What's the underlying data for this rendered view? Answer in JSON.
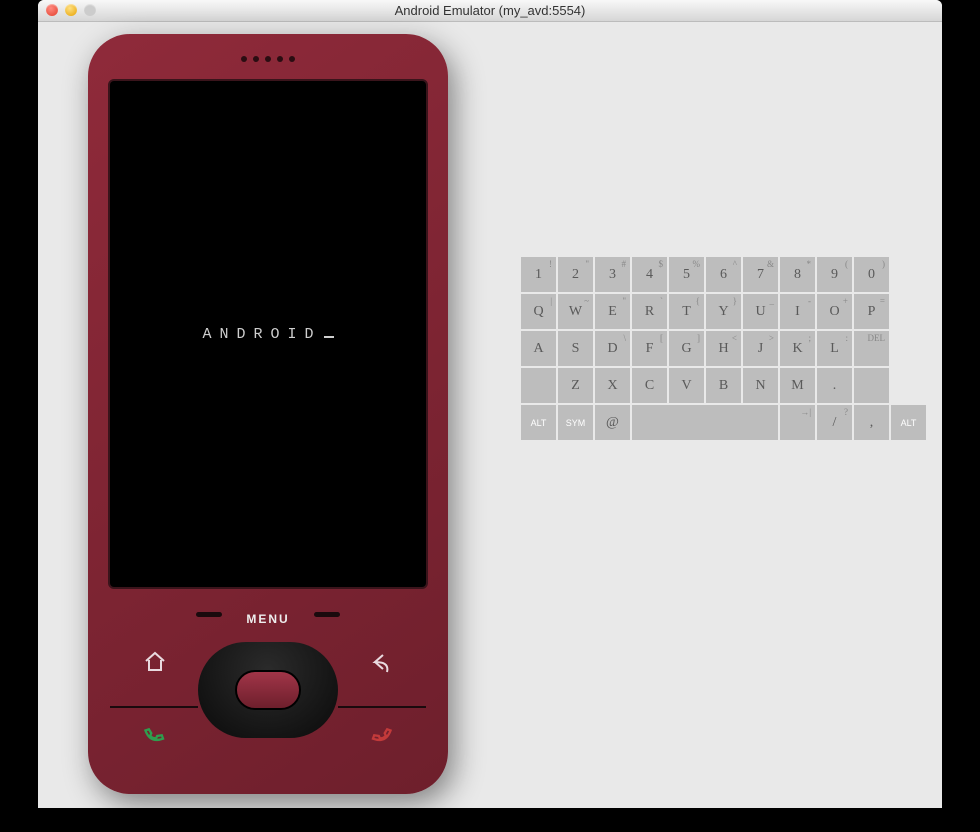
{
  "window": {
    "title": "Android Emulator (my_avd:5554)"
  },
  "device": {
    "screen_text": "ANDROID",
    "menu_label": "MENU"
  },
  "keyboard": {
    "rows": [
      [
        {
          "main": "1",
          "sup": "!"
        },
        {
          "main": "2",
          "sup": "\""
        },
        {
          "main": "3",
          "sup": "#"
        },
        {
          "main": "4",
          "sup": "$"
        },
        {
          "main": "5",
          "sup": "%"
        },
        {
          "main": "6",
          "sup": "^"
        },
        {
          "main": "7",
          "sup": "&"
        },
        {
          "main": "8",
          "sup": "*"
        },
        {
          "main": "9",
          "sup": "("
        },
        {
          "main": "0",
          "sup": ")"
        }
      ],
      [
        {
          "main": "Q",
          "sup": "|"
        },
        {
          "main": "W",
          "sup": "~"
        },
        {
          "main": "E",
          "sup": "\""
        },
        {
          "main": "R",
          "sup": "`"
        },
        {
          "main": "T",
          "sup": "{"
        },
        {
          "main": "Y",
          "sup": "}"
        },
        {
          "main": "U",
          "sup": "_"
        },
        {
          "main": "I",
          "sup": "-"
        },
        {
          "main": "O",
          "sup": "+"
        },
        {
          "main": "P",
          "sup": "="
        }
      ],
      [
        {
          "main": "A",
          "sup": ""
        },
        {
          "main": "S",
          "sup": ""
        },
        {
          "main": "D",
          "sup": "\\"
        },
        {
          "main": "F",
          "sup": "["
        },
        {
          "main": "G",
          "sup": "]"
        },
        {
          "main": "H",
          "sup": "<"
        },
        {
          "main": "J",
          "sup": ">"
        },
        {
          "main": "K",
          "sup": ";"
        },
        {
          "main": "L",
          "sup": ":"
        },
        {
          "main": "",
          "sup": "DEL",
          "name": "delete-key",
          "icon": "del"
        }
      ],
      [
        {
          "main": "",
          "sup": "",
          "name": "shift-key",
          "icon": "shift"
        },
        {
          "main": "Z",
          "sup": ""
        },
        {
          "main": "X",
          "sup": ""
        },
        {
          "main": "C",
          "sup": ""
        },
        {
          "main": "V",
          "sup": ""
        },
        {
          "main": "B",
          "sup": ""
        },
        {
          "main": "N",
          "sup": ""
        },
        {
          "main": "M",
          "sup": ""
        },
        {
          "main": ".",
          "sup": ""
        },
        {
          "main": "",
          "sup": "",
          "name": "enter-key",
          "icon": "enter"
        }
      ],
      [
        {
          "main": "ALT",
          "cls": "mod",
          "name": "alt-left-key"
        },
        {
          "main": "SYM",
          "cls": "mod",
          "name": "sym-key"
        },
        {
          "main": "@",
          "name": "at-key"
        },
        {
          "main": "",
          "cls": "wide4",
          "name": "space-key",
          "icon": "space"
        },
        {
          "main": "",
          "sup": "→|",
          "name": "tab-key",
          "icon": "tab"
        },
        {
          "main": "/",
          "sup": "?",
          "name": "slash-key"
        },
        {
          "main": ",",
          "sup": "",
          "name": "comma-key"
        },
        {
          "main": "ALT",
          "cls": "mod",
          "name": "alt-right-key"
        }
      ]
    ]
  }
}
